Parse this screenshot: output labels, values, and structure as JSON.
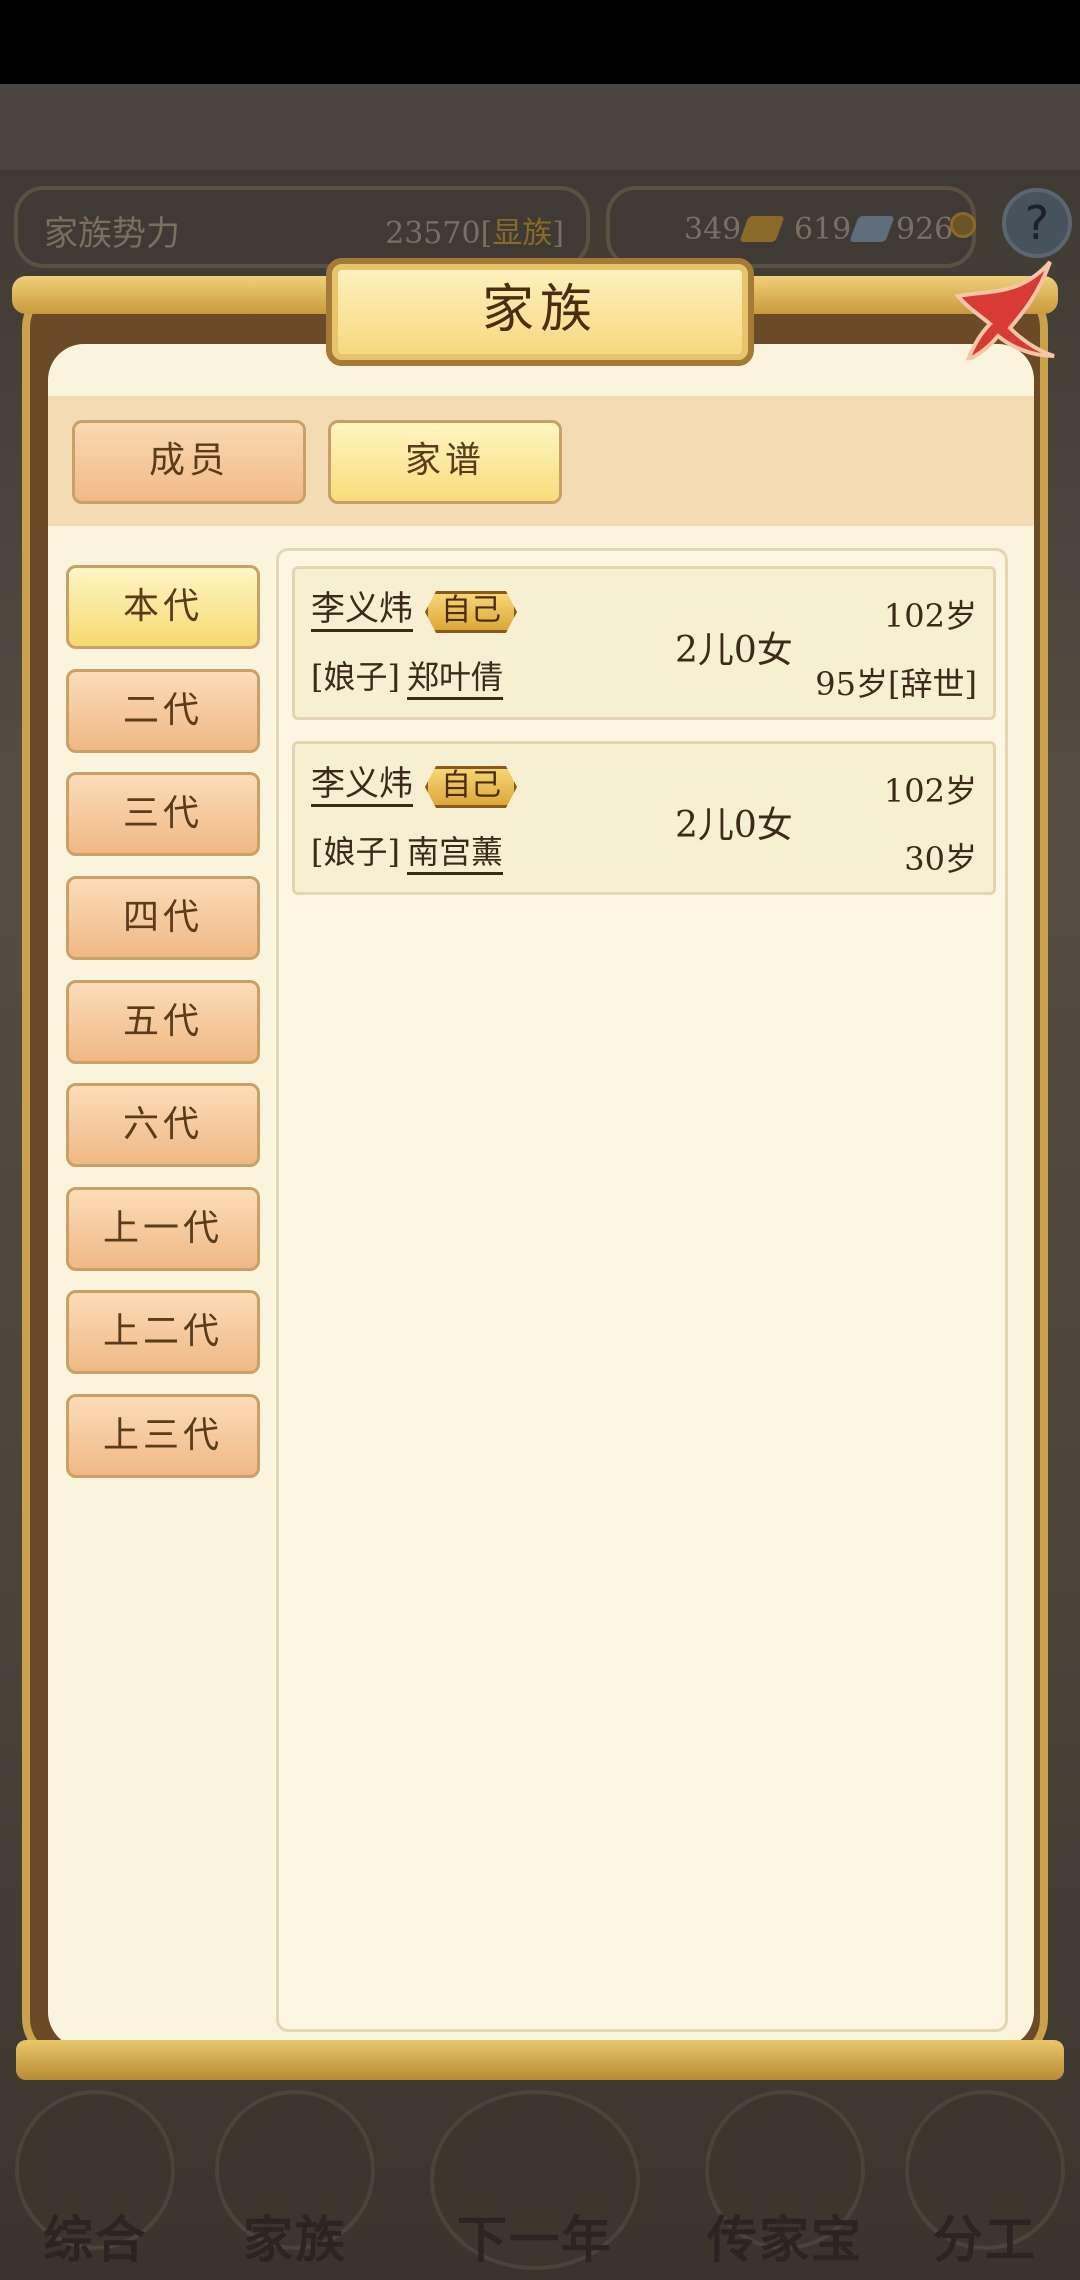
{
  "hud": {
    "clan_power_label": "家族势力",
    "clan_power_value": "23570",
    "clan_rank_open": "[",
    "clan_rank": "显族",
    "clan_rank_close": "]",
    "gold": "349",
    "silver": "619",
    "coins": "926",
    "help": "?"
  },
  "dialog": {
    "title": "家族",
    "tabs": [
      {
        "label": "成员",
        "active": false
      },
      {
        "label": "家谱",
        "active": true
      }
    ],
    "generations": [
      {
        "label": "本代",
        "active": true
      },
      {
        "label": "二代"
      },
      {
        "label": "三代"
      },
      {
        "label": "四代"
      },
      {
        "label": "五代"
      },
      {
        "label": "六代"
      },
      {
        "label": "上一代"
      },
      {
        "label": "上二代"
      },
      {
        "label": "上三代"
      }
    ],
    "records": [
      {
        "name": "李义炜",
        "badge": "自己",
        "spouse_tag": "[娘子]",
        "spouse": "郑叶倩",
        "children": "2儿0女",
        "age": "102岁",
        "spouse_age": "95岁[辞世]"
      },
      {
        "name": "李义炜",
        "badge": "自己",
        "spouse_tag": "[娘子]",
        "spouse": "南宫薰",
        "children": "2儿0女",
        "age": "102岁",
        "spouse_age": "30岁"
      }
    ]
  },
  "bottom_nav": [
    {
      "label": "综合"
    },
    {
      "label": "家族"
    },
    {
      "label": "下一年"
    },
    {
      "label": "传家宝"
    },
    {
      "label": "分工"
    }
  ],
  "colors": {
    "accent_gold": "#f6d67a",
    "close_red": "#d83a34",
    "text_brown": "#3b2a18"
  }
}
